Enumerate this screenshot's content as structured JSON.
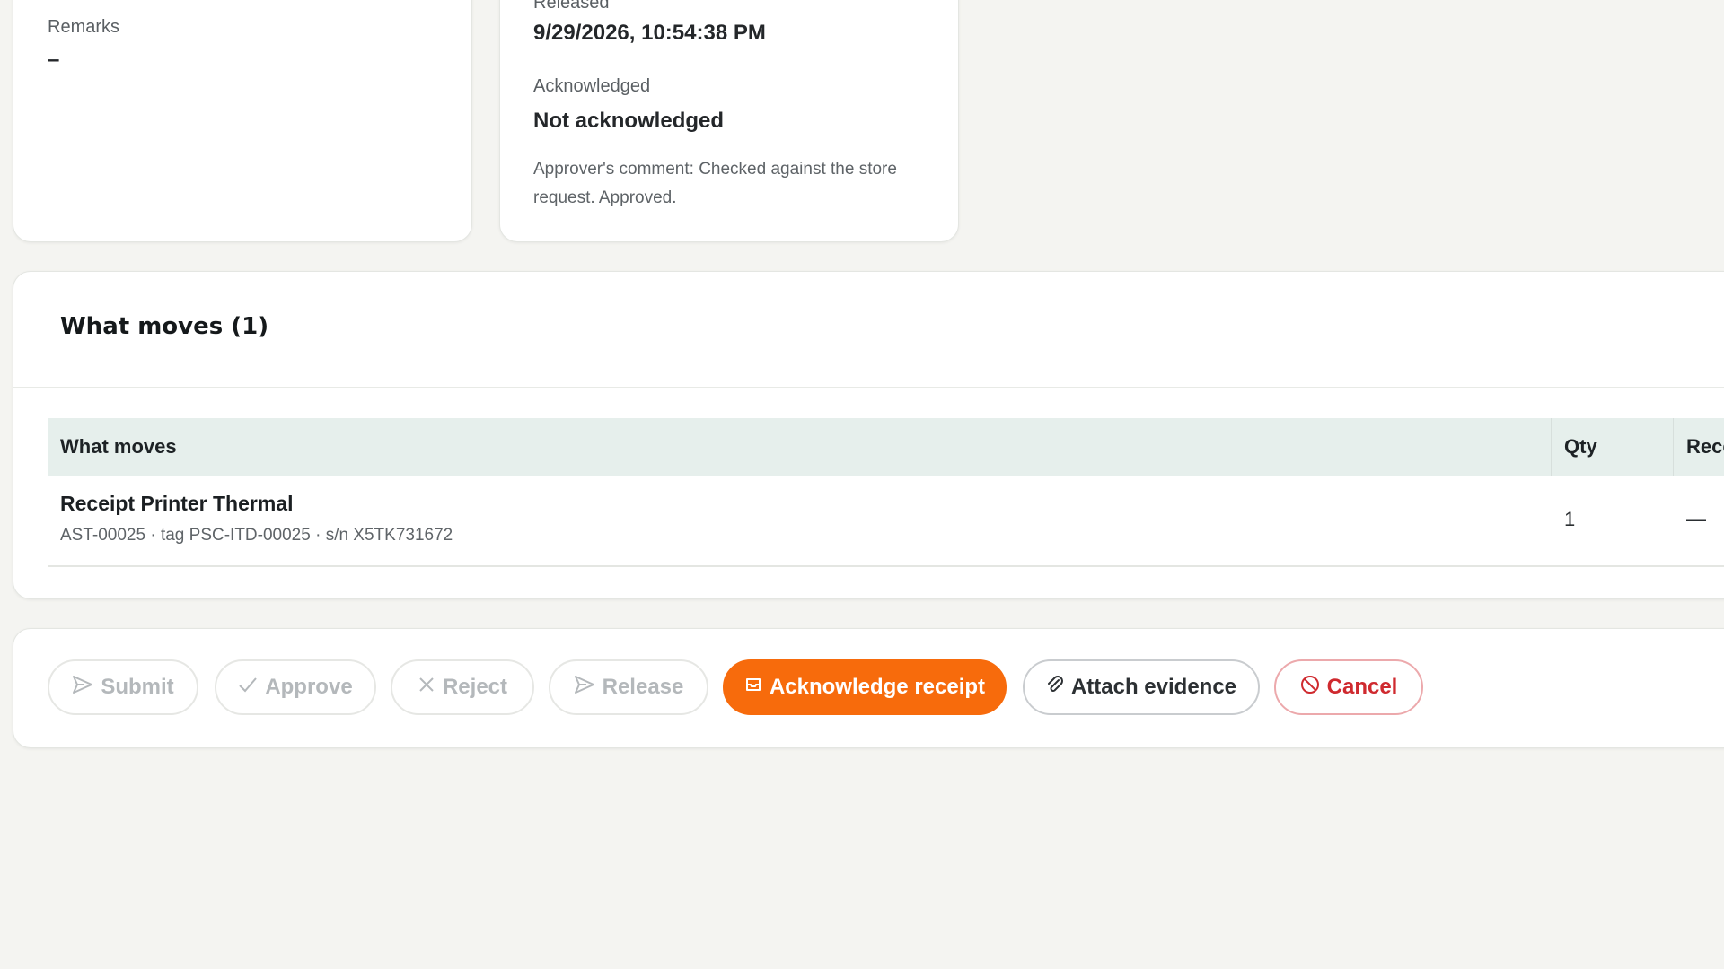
{
  "details_left": {
    "remarks_label": "Remarks",
    "remarks_value": "–"
  },
  "details_mid": {
    "released_label": "Released",
    "released_value": "9/29/2026, 10:54:38 PM",
    "acknowledged_label": "Acknowledged",
    "acknowledged_value": "Not acknowledged",
    "approver_comment": "Approver's comment: Checked against the store request. Approved."
  },
  "moves": {
    "title": "What moves (1)",
    "columns": [
      "What moves",
      "Qty",
      "Received"
    ],
    "rows": [
      {
        "name": "Receipt Printer Thermal",
        "meta": "AST-00025 · tag PSC-ITD-00025 · s/n X5TK731672",
        "qty": "1",
        "received": "—"
      }
    ]
  },
  "actions": {
    "submit": "Submit",
    "approve": "Approve",
    "reject": "Reject",
    "release": "Release",
    "acknowledge": "Acknowledge receipt",
    "attach": "Attach evidence",
    "cancel": "Cancel",
    "primary_color": "#f76b0c",
    "danger_color": "#cf2a2f"
  },
  "icons": {
    "submit": "send-icon",
    "approve": "check-icon",
    "reject": "x-icon",
    "release": "send-icon",
    "acknowledge": "inbox-icon",
    "attach": "paperclip-icon",
    "cancel": "ban-icon"
  }
}
